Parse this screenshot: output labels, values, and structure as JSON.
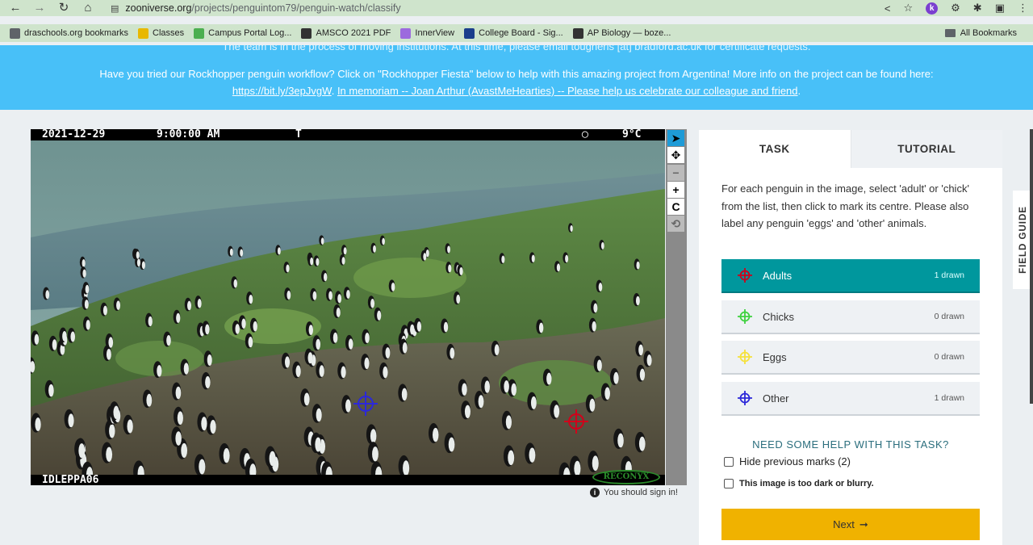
{
  "browser": {
    "url_host": "zooniverse.org",
    "url_path": "/projects/penguintom79/penguin-watch/classify",
    "avatar_letter": "k"
  },
  "bookmarks": {
    "items": [
      {
        "label": "draschools.org bookmarks",
        "icon": "folder-icon",
        "color": "#5f6368"
      },
      {
        "label": "Classes",
        "icon": "classes-icon",
        "color": "#e8b800"
      },
      {
        "label": "Campus Portal Log...",
        "icon": "campus-portal-icon",
        "color": "#4caf50"
      },
      {
        "label": "AMSCO 2021 PDF",
        "icon": "amsco-icon",
        "color": "#333333"
      },
      {
        "label": "InnerView",
        "icon": "innerview-icon",
        "color": "#9c6ade"
      },
      {
        "label": "College Board - Sig...",
        "icon": "college-board-icon",
        "color": "#1a3e8c"
      },
      {
        "label": "AP Biology — boze...",
        "icon": "ap-biology-icon",
        "color": "#333333"
      }
    ],
    "all_bookmarks": "All Bookmarks"
  },
  "banner": {
    "top_line": "The team is in the process of moving institutions. At this time, please email tougheris [at] bradford.ac.uk for certificate requests.",
    "line1": "Have you tried our Rockhopper penguin workflow? Click on \"Rockhopper Fiesta\" below to help with this amazing project from Argentina! More info on the project can be found here:",
    "link1": "https://bit.ly/3epJvgW",
    "link2": "In memoriam -- Joan Arthur (AvastMeHearties) -- Please help us celebrate our colleague and friend",
    "period": "."
  },
  "camera": {
    "date": "2021-12-29",
    "time": "9:00:00 AM",
    "t_label": "T",
    "temp": "9°C",
    "site": "IDLEPPA06",
    "brand": "RECONYX"
  },
  "sign_in": "You should sign in!",
  "panel": {
    "tab_task": "TASK",
    "tab_tutorial": "TUTORIAL",
    "instructions": "For each penguin in the image, select 'adult' or 'chick' from the list, then click to mark its centre. Please also label any penguin 'eggs' and 'other' animals.",
    "choices": [
      {
        "label": "Adults",
        "count": "1 drawn",
        "color": "#d0021b",
        "selected": true
      },
      {
        "label": "Chicks",
        "count": "0 drawn",
        "color": "#3fd13f",
        "selected": false
      },
      {
        "label": "Eggs",
        "count": "0 drawn",
        "color": "#f5e13b",
        "selected": false
      },
      {
        "label": "Other",
        "count": "1 drawn",
        "color": "#2c28d9",
        "selected": false
      }
    ],
    "help": "NEED SOME HELP WITH THIS TASK?",
    "hide_marks": "Hide previous marks (2)",
    "too_dark": "This image is too dark or blurry.",
    "next": "Next"
  },
  "field_guide": "FIELD GUIDE"
}
